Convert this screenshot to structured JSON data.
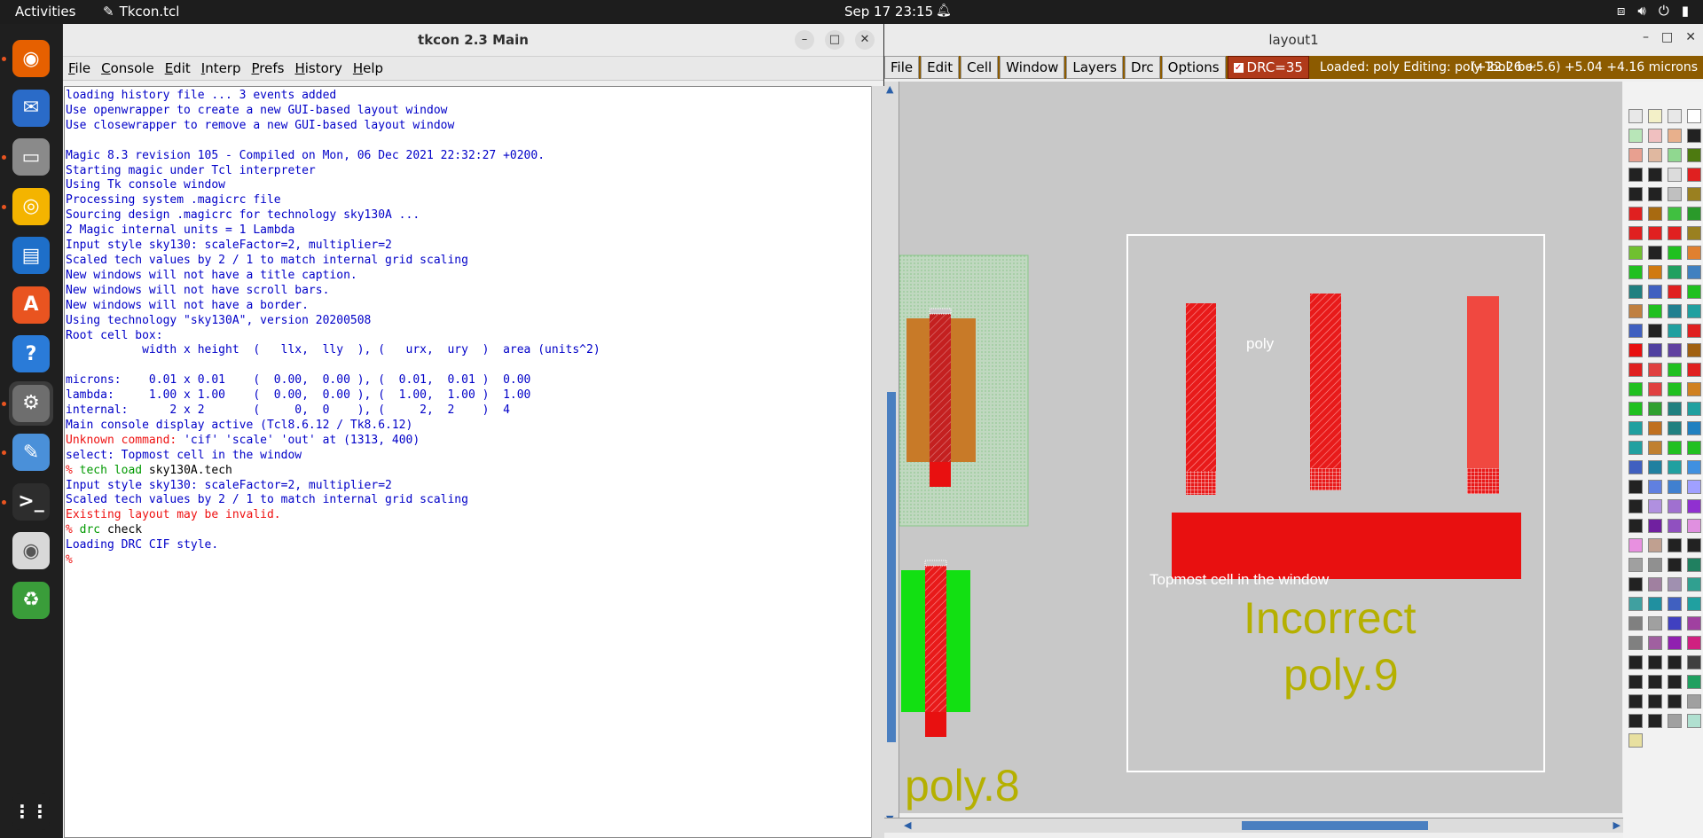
{
  "topbar": {
    "activities": "Activities",
    "app_name": "Tkcon.tcl",
    "clock": "Sep 17  23:15"
  },
  "dock": {
    "items": [
      {
        "name": "firefox",
        "color": "#e66000"
      },
      {
        "name": "thunderbird",
        "color": "#2a6bc8"
      },
      {
        "name": "files",
        "color": "#8a8a8a"
      },
      {
        "name": "rhythmbox",
        "color": "#f4b400"
      },
      {
        "name": "libreoffice-writer",
        "color": "#1e6fc9"
      },
      {
        "name": "app-center",
        "color": "#e95420"
      },
      {
        "name": "help",
        "color": "#2a7bd8"
      },
      {
        "name": "settings",
        "color": "#6e6e6e"
      },
      {
        "name": "text-editor",
        "color": "#4a90d9"
      },
      {
        "name": "terminal",
        "color": "#2d2d2d"
      },
      {
        "name": "disc",
        "color": "#d8d8d8"
      },
      {
        "name": "trash",
        "color": "#3a9d3a"
      },
      {
        "name": "show-apps",
        "color": "#1f1f1f"
      }
    ]
  },
  "tkcon": {
    "title": "tkcon 2.3 Main",
    "menus": [
      "File",
      "Console",
      "Edit",
      "Interp",
      "Prefs",
      "History",
      "Help"
    ],
    "lines": [
      {
        "t": "loading history file ... 3 events added",
        "c": "out"
      },
      {
        "t": "Use openwrapper to create a new GUI-based layout window",
        "c": "out"
      },
      {
        "t": "Use closewrapper to remove a new GUI-based layout window",
        "c": "out"
      },
      {
        "t": "",
        "c": "out"
      },
      {
        "t": "Magic 8.3 revision 105 - Compiled on Mon, 06 Dec 2021 22:32:27 +0200.",
        "c": "out"
      },
      {
        "t": "Starting magic under Tcl interpreter",
        "c": "out"
      },
      {
        "t": "Using Tk console window",
        "c": "out"
      },
      {
        "t": "Processing system .magicrc file",
        "c": "out"
      },
      {
        "t": "Sourcing design .magicrc for technology sky130A ...",
        "c": "out"
      },
      {
        "t": "2 Magic internal units = 1 Lambda",
        "c": "out"
      },
      {
        "t": "Input style sky130: scaleFactor=2, multiplier=2",
        "c": "out"
      },
      {
        "t": "Scaled tech values by 2 / 1 to match internal grid scaling",
        "c": "out"
      },
      {
        "t": "New windows will not have a title caption.",
        "c": "out"
      },
      {
        "t": "New windows will not have scroll bars.",
        "c": "out"
      },
      {
        "t": "New windows will not have a border.",
        "c": "out"
      },
      {
        "t": "Using technology \"sky130A\", version 20200508",
        "c": "out"
      },
      {
        "t": "Root cell box:",
        "c": "out"
      },
      {
        "t": "           width x height  (   llx,  lly  ), (   urx,  ury  )  area (units^2)",
        "c": "out"
      },
      {
        "t": "",
        "c": "out"
      },
      {
        "t": "microns:    0.01 x 0.01    (  0.00,  0.00 ), (  0.01,  0.01 )  0.00",
        "c": "out"
      },
      {
        "t": "lambda:     1.00 x 1.00    (  0.00,  0.00 ), (  1.00,  1.00 )  1.00",
        "c": "out"
      },
      {
        "t": "internal:      2 x 2       (     0,  0    ), (     2,  2    )  4",
        "c": "out"
      },
      {
        "t": "Main console display active (Tcl8.6.12 / Tk8.6.12)",
        "c": "out"
      },
      {
        "t": "Unknown command: ",
        "c": "err",
        "rest": "'cif' 'scale' 'out' at (1313, 400)"
      },
      {
        "t": "select: Topmost cell in the window",
        "c": "out"
      },
      {
        "t": "% ",
        "c": "prm",
        "cmd1": "tech load",
        "cmd2": " sky130A.tech"
      },
      {
        "t": "Input style sky130: scaleFactor=2, multiplier=2",
        "c": "out"
      },
      {
        "t": "Scaled tech values by 2 / 1 to match internal grid scaling",
        "c": "out"
      },
      {
        "t": "Existing layout may be invalid.",
        "c": "err"
      },
      {
        "t": "% ",
        "c": "prm",
        "cmd1": "drc",
        "cmd2": " check"
      },
      {
        "t": "Loading DRC CIF style.",
        "c": "out"
      },
      {
        "t": "%",
        "c": "err"
      }
    ]
  },
  "magic": {
    "title": "layout1",
    "menus": [
      "File",
      "Edit",
      "Cell",
      "Window",
      "Layers",
      "Drc",
      "Options"
    ],
    "drc_label": "DRC=35",
    "status": "Loaded: poly Editing: poly Tool: bo:",
    "coords": "(+22.26 +5.6) +5.04 +4.16 microns",
    "labels": {
      "poly": "poly",
      "topmost": "Topmost cell in the window",
      "incorrect": "Incorrect",
      "poly9": "poly.9",
      "poly8": "poly.8"
    }
  },
  "palette_colors": [
    "#e8e8e8",
    "#f3f0c8",
    "#e8e8e8",
    "#ffffff",
    "#b8e6b8",
    "#f0c0c0",
    "#e8b08c",
    "#222222",
    "#e8a090",
    "#e0b8a0",
    "#90d890",
    "#4d7a10",
    "#222222",
    "#222222",
    "#dcdcdc",
    "#e02020",
    "#222222",
    "#222222",
    "#c0c0c0",
    "#9a8020",
    "#e02020",
    "#a86a10",
    "#40c040",
    "#2a9a2a",
    "#e02020",
    "#e02020",
    "#e02020",
    "#9a8020",
    "#70c030",
    "#222222",
    "#20c020",
    "#e08030",
    "#20c020",
    "#d07a10",
    "#20a060",
    "#4080c0",
    "#208080",
    "#4060c0",
    "#e02020",
    "#20c020",
    "#c08040",
    "#20c020",
    "#208090",
    "#20a0a0",
    "#4060c0",
    "#222222",
    "#20a0a0",
    "#e02020",
    "#e81010",
    "#5040a0",
    "#6040a0",
    "#a06010",
    "#e02020",
    "#e04040",
    "#20c020",
    "#e02020",
    "#20c020",
    "#e04040",
    "#20c020",
    "#d08020",
    "#20c020",
    "#30a030",
    "#208080",
    "#20a0a0",
    "#20a0a0",
    "#c07020",
    "#208080",
    "#2080c0",
    "#20a0a0",
    "#c08030",
    "#20c020",
    "#20c020",
    "#4060c0",
    "#2080a0",
    "#20a0a0",
    "#4090e0",
    "#222222",
    "#6080e0",
    "#4080d0",
    "#a0a0ff",
    "#222222",
    "#b090e0",
    "#a070d0",
    "#9030d0",
    "#222222",
    "#7020a0",
    "#9050c0",
    "#e090e0",
    "#e890e0",
    "#c0a090",
    "#222222",
    "#222222",
    "#a0a0a0",
    "#909090",
    "#222222",
    "#208060",
    "#222222",
    "#a080a0",
    "#a090b0",
    "#30a090",
    "#40a0a0",
    "#2090a0",
    "#4060c0",
    "#20a0a0",
    "#808080",
    "#a0a0a0",
    "#4040c0",
    "#a040a0",
    "#808080",
    "#a060a0",
    "#9020b0",
    "#d02080",
    "#222222",
    "#222222",
    "#222222",
    "#404040",
    "#222222",
    "#222222",
    "#222222",
    "#20a060",
    "#222222",
    "#222222",
    "#222222",
    "#a0a0a0",
    "#222222",
    "#222222",
    "#a0a0a0",
    "#b0e0d0",
    "#e8e0a0"
  ]
}
